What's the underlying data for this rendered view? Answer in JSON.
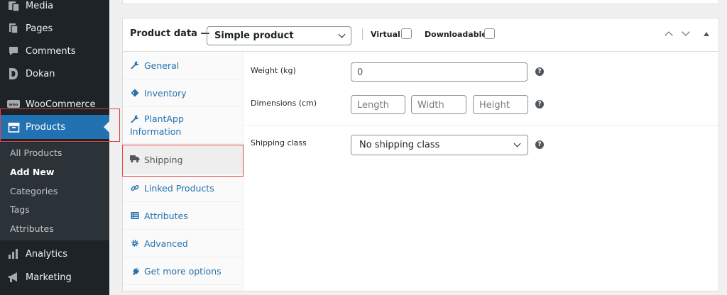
{
  "sidebar": {
    "items": [
      {
        "label": "Media",
        "icon": "media-icon"
      },
      {
        "label": "Pages",
        "icon": "pages-icon"
      },
      {
        "label": "Comments",
        "icon": "comments-icon"
      },
      {
        "label": "Dokan",
        "icon": "dokan-icon"
      },
      {
        "label": "WooCommerce",
        "icon": "woocommerce-icon"
      },
      {
        "label": "Products",
        "icon": "products-icon"
      },
      {
        "label": "Analytics",
        "icon": "analytics-icon"
      },
      {
        "label": "Marketing",
        "icon": "marketing-icon"
      }
    ],
    "submenu": [
      "All Products",
      "Add New",
      "Categories",
      "Tags",
      "Attributes"
    ]
  },
  "product_data": {
    "title": "Product data —",
    "type_select": "Simple product",
    "virtual_label": "Virtual:",
    "downloadable_label": "Downloadable:",
    "tabs": [
      {
        "label": "General",
        "icon": "wrench-icon"
      },
      {
        "label": "Inventory",
        "icon": "tag-icon"
      },
      {
        "label_line1": "PlantApp",
        "label_line2": "Information",
        "icon": "wrench-icon"
      },
      {
        "label": "Shipping",
        "icon": "truck-icon"
      },
      {
        "label": "Linked Products",
        "icon": "link-icon"
      },
      {
        "label": "Attributes",
        "icon": "list-icon"
      },
      {
        "label": "Advanced",
        "icon": "gear-icon"
      },
      {
        "label": "Get more options",
        "icon": "plug-icon"
      }
    ],
    "shipping": {
      "weight_label": "Weight (kg)",
      "weight_value": "0",
      "dimensions_label": "Dimensions (cm)",
      "length_placeholder": "Length",
      "width_placeholder": "Width",
      "height_placeholder": "Height",
      "shipping_class_label": "Shipping class",
      "shipping_class_value": "No shipping class"
    }
  },
  "colors": {
    "sidebar_bg": "#1d2327",
    "active_blue": "#2271b1",
    "highlight_red": "#e0443e"
  }
}
